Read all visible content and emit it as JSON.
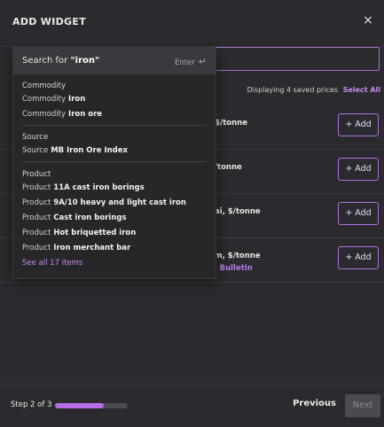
{
  "modal": {
    "title": "ADD WIDGET",
    "close_glyph": "×"
  },
  "list": {
    "displaying_text": "Displaying 4 saved prices",
    "select_all": "Select All",
    "rows": [
      {
        "label": ", $/tonne",
        "sub": ""
      },
      {
        "label": "$/tonne",
        "sub": "n"
      },
      {
        "label": "hai, $/tonne",
        "sub": "n"
      },
      {
        "label": "em, $/tonne",
        "sub": "al Bulletin"
      }
    ],
    "add_label": "+ Add"
  },
  "footer": {
    "step_text": "Step 2 of 3",
    "progress_fraction": 0.67,
    "previous": "Previous",
    "next": "Next"
  },
  "dropdown": {
    "search_prefix": "Search for ",
    "search_query": "\"iron\"",
    "enter_label": "Enter",
    "enter_glyph": "↵",
    "groups": [
      {
        "title": "Commodity",
        "items": [
          {
            "type": "Commodity",
            "value": "Iron"
          },
          {
            "type": "Commodity",
            "value": "Iron ore"
          }
        ]
      },
      {
        "title": "Source",
        "items": [
          {
            "type": "Source",
            "value": "MB Iron Ore Index"
          }
        ]
      },
      {
        "title": "Product",
        "items": [
          {
            "type": "Product",
            "value": "11A cast iron borings"
          },
          {
            "type": "Product",
            "value": "9A/10 heavy and light cast iron"
          },
          {
            "type": "Product",
            "value": "Cast iron borings"
          },
          {
            "type": "Product",
            "value": "Hot briquetted iron"
          },
          {
            "type": "Product",
            "value": "Iron merchant bar"
          }
        ]
      }
    ],
    "see_all": "See all 17 items"
  },
  "colors": {
    "accent": "#b56ee8",
    "background": "#2b2b2f",
    "dropdown_bg": "#27272a"
  }
}
